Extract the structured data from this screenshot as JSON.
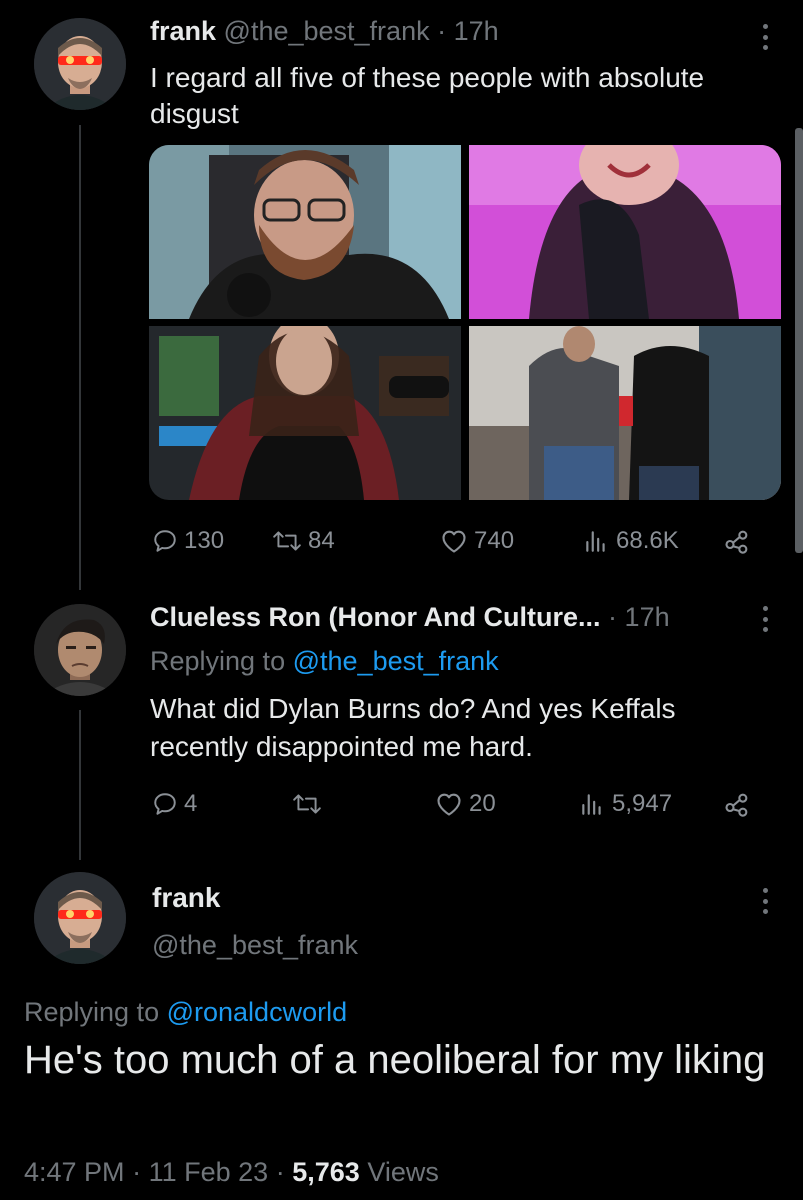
{
  "tweet1": {
    "author_name": "frank",
    "author_handle": "@the_best_frank",
    "separator": "·",
    "time": "17h",
    "text": "I regard all five of these people with absolute disgust",
    "media_images": [
      "man-with-glasses-and-beard-photo",
      "woman-with-pink-background-photo",
      "woman-in-plaid-shirt-photo",
      "two-people-at-convention-photo"
    ],
    "stats": {
      "replies": "130",
      "retweets": "84",
      "likes": "740",
      "views": "68.6K"
    }
  },
  "tweet2": {
    "author_name": "Clueless Ron (Honor And Culture...",
    "separator": "·",
    "time": "17h",
    "replying_prefix": "Replying to",
    "replying_handle": "@the_best_frank",
    "text": "What did Dylan Burns do? And yes Keffals recently disappointed me hard.",
    "stats": {
      "replies": "4",
      "retweets": "",
      "likes": "20",
      "views": "5,947"
    }
  },
  "main_tweet": {
    "author_name": "frank",
    "author_handle": "@the_best_frank",
    "replying_prefix": "Replying to",
    "replying_handle": "@ronaldcworld",
    "text": "He's too much of a neoliberal for my liking",
    "time": "4:47 PM",
    "date": "11 Feb 23",
    "separator": "·",
    "views_count": "5,763",
    "views_label": "Views"
  },
  "icons": [
    "reply-icon",
    "retweet-icon",
    "like-icon",
    "views-icon",
    "share-icon",
    "more-icon"
  ],
  "colors": {
    "background": "#000000",
    "text": "#e7e9ea",
    "muted": "#71767b",
    "link": "#1d9bf0",
    "thread_line": "#333639"
  }
}
